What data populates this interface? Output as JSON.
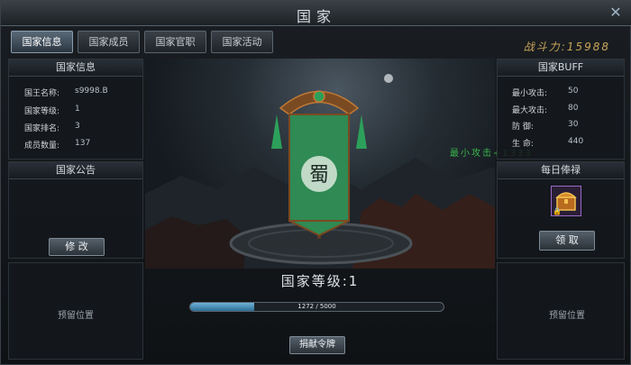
{
  "window": {
    "title": "国家"
  },
  "tabs": [
    {
      "label": "国家信息"
    },
    {
      "label": "国家成员"
    },
    {
      "label": "国家官职"
    },
    {
      "label": "国家活动"
    }
  ],
  "power": {
    "label": "战斗力:15988"
  },
  "info": {
    "header": "国家信息",
    "rows": [
      {
        "label": "国王名称:",
        "value": "s9998.B"
      },
      {
        "label": "国家等级:",
        "value": "1"
      },
      {
        "label": "国家排名:",
        "value": "3"
      },
      {
        "label": "成员数量:",
        "value": "137"
      }
    ]
  },
  "notice": {
    "header": "国家公告",
    "edit_label": "修 改"
  },
  "reserved_left": "预留位置",
  "buff": {
    "header": "国家BUFF",
    "rows": [
      {
        "label": "最小攻击:",
        "value": "50"
      },
      {
        "label": "最大攻击:",
        "value": "80"
      },
      {
        "label": "防    御:",
        "value": "30"
      },
      {
        "label": "生    命:",
        "value": "440"
      }
    ]
  },
  "float_text": "最小攻击+1333",
  "salary": {
    "header": "每日俸禄",
    "claim_label": "领 取"
  },
  "reserved_right": "预留位置",
  "banner": {
    "glyph": "蜀"
  },
  "level": {
    "title": "国家等级:1",
    "progress_text": "1272 / 5000",
    "current": 1272,
    "max": 5000
  },
  "donate_label": "捐献令牌",
  "colors": {
    "accent_gold": "#c9a45a",
    "banner_green": "#2f8a53",
    "progress_blue": "#3d8cc0"
  }
}
